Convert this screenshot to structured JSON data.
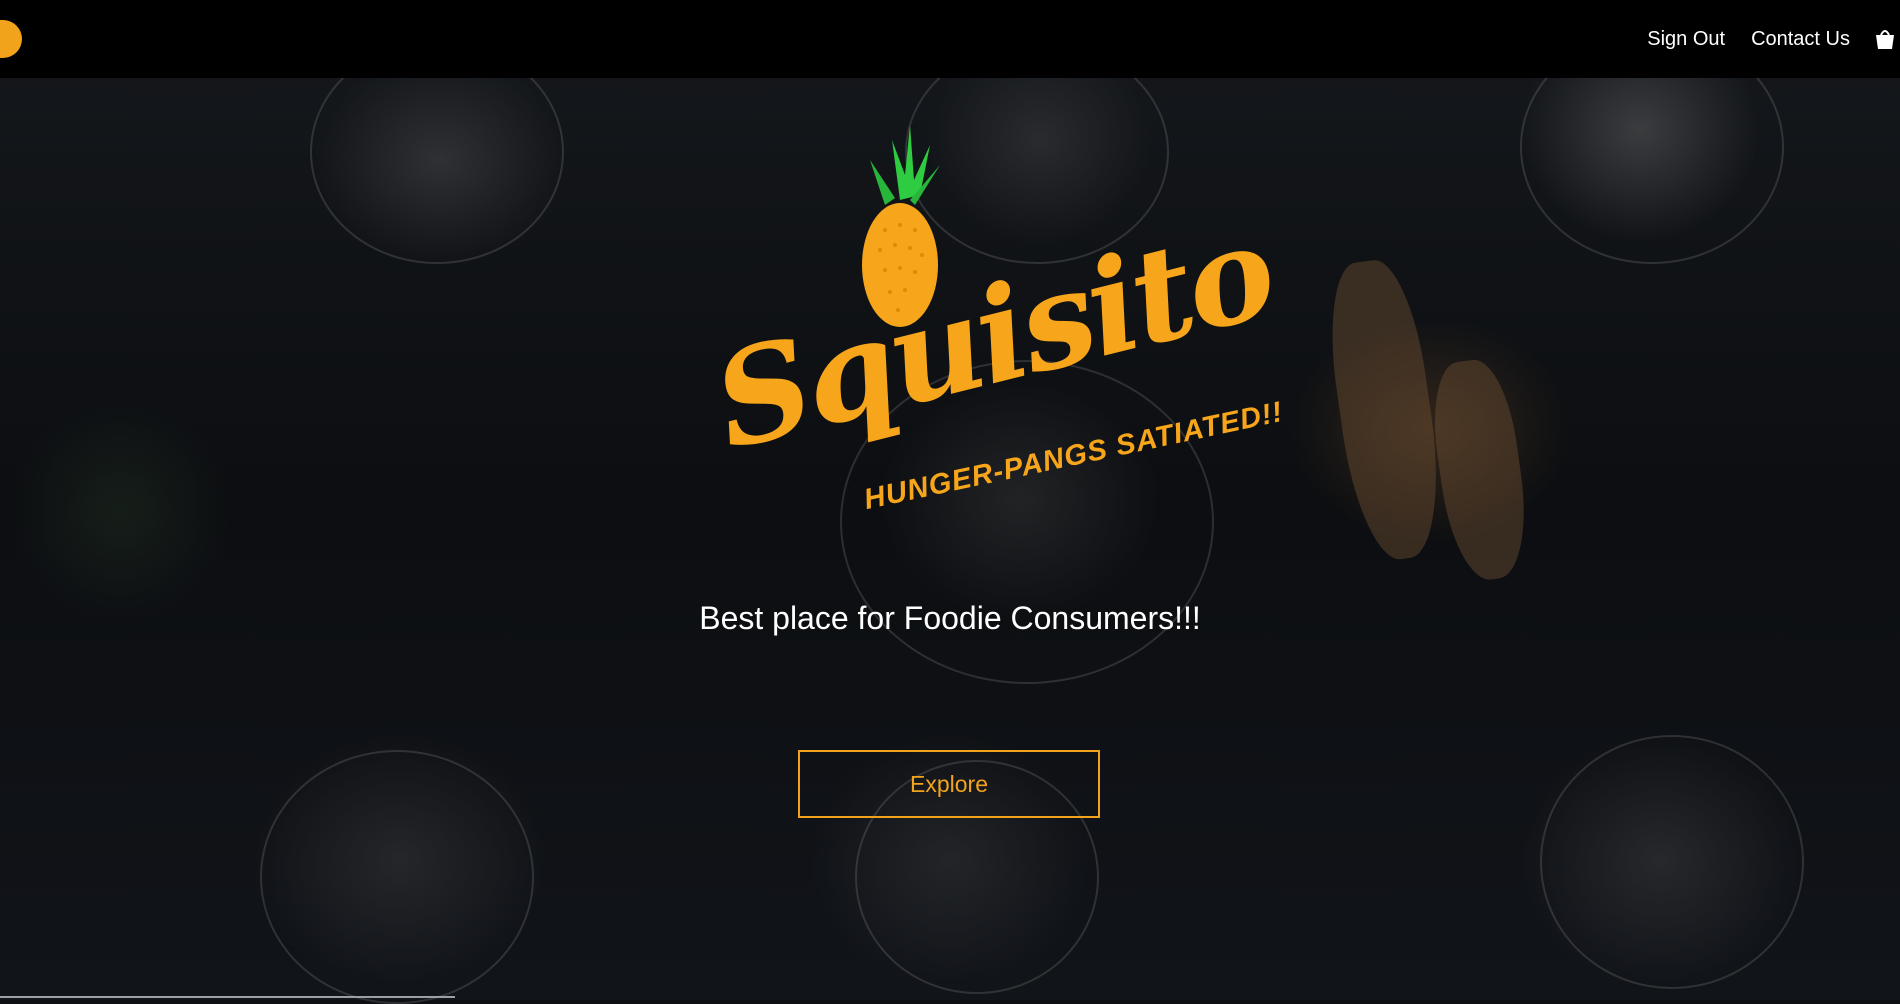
{
  "nav": {
    "links": [
      "Sign Out",
      "Contact Us"
    ],
    "cart_icon": "cart-icon"
  },
  "logo": {
    "wordmark": "Squisito",
    "tagline": "HUNGER-PANGS SATIATED!!",
    "icon": "pineapple-icon"
  },
  "hero": {
    "subtitle": "Best place for Foodie Consumers!!!",
    "cta_label": "Explore"
  },
  "colors": {
    "accent": "#f2a31c",
    "nav_bg": "#000000",
    "leaf": "#2ecc40"
  }
}
